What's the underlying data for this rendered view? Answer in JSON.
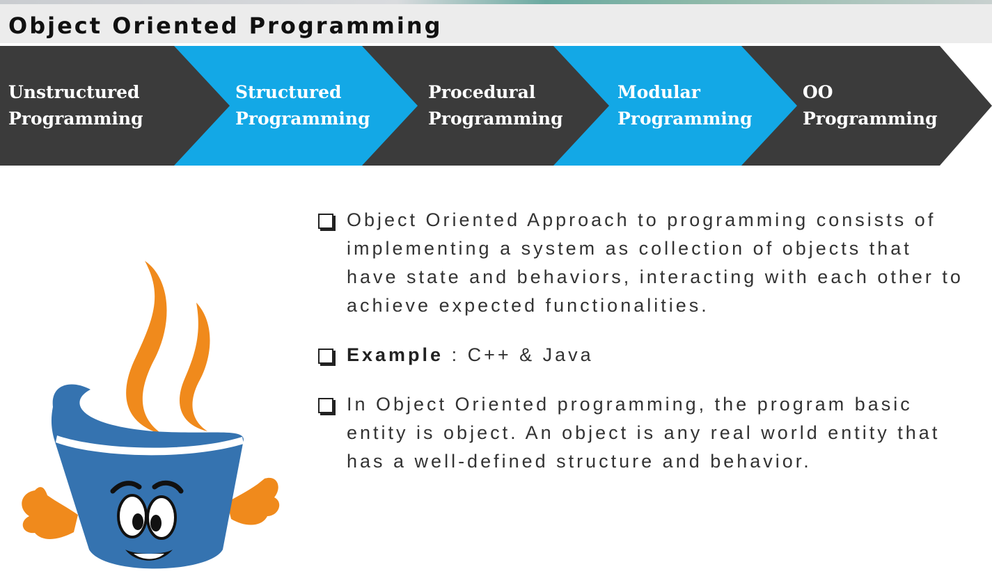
{
  "title": "Object Oriented Programming",
  "stages": [
    {
      "line1": "Unstructured",
      "line2": "Programming",
      "color": "#3b3b3b"
    },
    {
      "line1": "Structured",
      "line2": "Programming",
      "color": "#13a8e6"
    },
    {
      "line1": "Procedural",
      "line2": "Programming",
      "color": "#3b3b3b"
    },
    {
      "line1": "Modular",
      "line2": "Programming",
      "color": "#13a8e6"
    },
    {
      "line1": "OO",
      "line2": "Programming",
      "color": "#3b3b3b"
    }
  ],
  "bullets": {
    "b1": "Object Oriented Approach to programming consists of implementing a system as collection of objects that have state and behaviors, interacting with each other to achieve expected functionalities.",
    "b2_label": "Example",
    "b2_sep": " : ",
    "b2_text": "C++ & Java",
    "b3": "In Object Oriented programming, the program basic entity is object. An object is any real world entity that has a well-defined structure and behavior."
  },
  "mascot": {
    "icon": "java-coffee-cup-icon",
    "cup_color": "#3573b0",
    "steam_color": "#f08a1c"
  }
}
